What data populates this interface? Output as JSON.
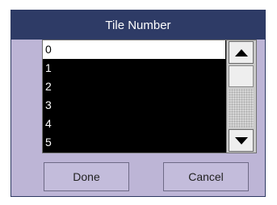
{
  "dialog": {
    "title": "Tile Number",
    "items": [
      "0",
      "1",
      "2",
      "3",
      "4",
      "5"
    ],
    "selected_index": 0,
    "buttons": {
      "done_label": "Done",
      "cancel_label": "Cancel"
    },
    "icons": {
      "scroll_up": "triangle-up-icon",
      "scroll_down": "triangle-down-icon"
    }
  }
}
